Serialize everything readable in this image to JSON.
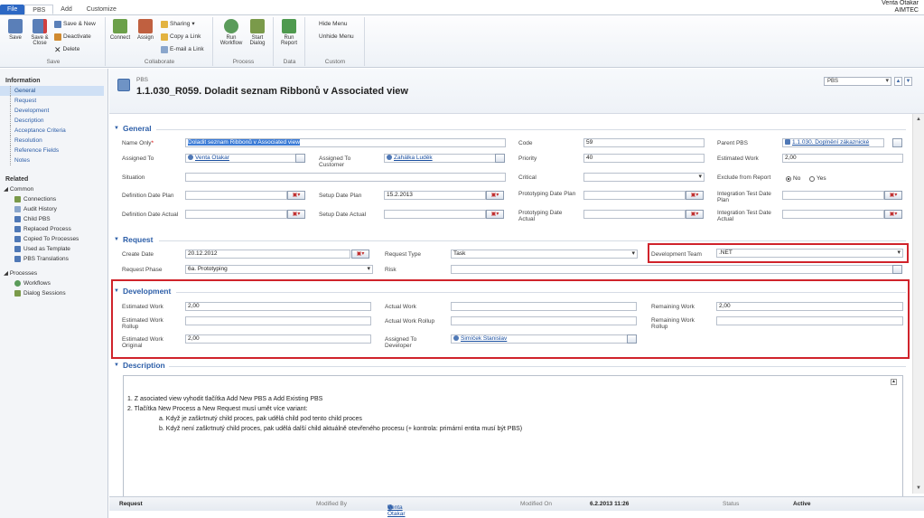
{
  "user": {
    "name": "Venta Otakar",
    "org": "AIMTEC"
  },
  "tabs": [
    "File",
    "PBS",
    "Add",
    "Customize"
  ],
  "ribbon": {
    "groups": {
      "save": {
        "label": "Save",
        "save": "Save",
        "save_close": "Save & Close",
        "save_new": "Save & New",
        "deactivate": "Deactivate",
        "delete": "Delete"
      },
      "collaborate": {
        "label": "Collaborate",
        "connect": "Connect",
        "assign": "Assign",
        "sharing": "Sharing",
        "copy_link": "Copy a Link",
        "email_link": "E-mail a Link"
      },
      "process": {
        "label": "Process",
        "run_workflow": "Run Workflow",
        "start_dialog": "Start Dialog"
      },
      "data": {
        "label": "Data",
        "run_report": "Run Report"
      },
      "custom": {
        "label": "Custom",
        "hide_menu": "Hide Menu",
        "unhide_menu": "Unhide Menu"
      }
    }
  },
  "nav": {
    "information_title": "Information",
    "information_items": [
      "General",
      "Request",
      "Development",
      "Description",
      "Acceptance Criteria",
      "Resolution",
      "Reference Fields",
      "Notes"
    ],
    "related_title": "Related",
    "common_title": "Common",
    "common_items": [
      "Connections",
      "Audit History",
      "Child PBS",
      "Replaced Process",
      "Copied To Processes",
      "Used as Template",
      "PBS Translations"
    ],
    "processes_title": "Processes",
    "processes_items": [
      "Workflows",
      "Dialog Sessions"
    ]
  },
  "header": {
    "entity": "PBS",
    "title": "1.1.030_R059. Doladit seznam Ribbonů v Associated view",
    "form_selector": "PBS"
  },
  "general": {
    "title": "General",
    "name_only_label": "Name Only",
    "name_only_value": "Doladit seznam Ribbonů v Associated view",
    "assigned_to_label": "Assigned To",
    "assigned_to_value": "Venta Otakar",
    "assigned_to_customer_label": "Assigned To Customer",
    "assigned_to_customer_value": "Zahálka Luděk",
    "situation_label": "Situation",
    "def_date_plan_label": "Definition Date Plan",
    "setup_date_plan_label": "Setup Date Plan",
    "setup_date_plan_value": "15.2.2013",
    "def_date_actual_label": "Definition Date Actual",
    "setup_date_actual_label": "Setup Date Actual",
    "code_label": "Code",
    "code_value": "59",
    "priority_label": "Priority",
    "priority_value": "40",
    "critical_label": "Critical",
    "proto_date_plan_label": "Prototyping Date Plan",
    "proto_date_actual_label": "Prototyping Date Actual",
    "parent_pbs_label": "Parent PBS",
    "parent_pbs_value": "1.1.030. Doplnění zákaznické",
    "estimated_work_label": "Estimated Work",
    "estimated_work_value": "2,00",
    "exclude_report_label": "Exclude from Report",
    "radio_no": "No",
    "radio_yes": "Yes",
    "integration_date_plan_label": "Integration Test Date Plan",
    "integration_date_actual_label": "Integration Test Date Actual"
  },
  "request": {
    "title": "Request",
    "create_date_label": "Create Date",
    "create_date_value": "20.12.2012",
    "request_type_label": "Request Type",
    "request_type_value": "Task",
    "dev_team_label": "Development Team",
    "dev_team_value": ".NET",
    "request_phase_label": "Request Phase",
    "request_phase_value": "6a. Prototyping",
    "risk_label": "Risk"
  },
  "development": {
    "title": "Development",
    "estimated_work_label": "Estimated Work",
    "estimated_work_value": "2,00",
    "est_work_rollup_label": "Estimated Work Rollup",
    "est_work_original_label": "Estimated Work Original",
    "est_work_original_value": "2,00",
    "actual_work_label": "Actual Work",
    "actual_work_rollup_label": "Actual Work Rollup",
    "assigned_dev_label": "Assigned To Developer",
    "assigned_dev_value": "Šimíček Stanislav",
    "remaining_work_label": "Remaining Work",
    "remaining_work_value": "2,00",
    "remaining_rollup_label": "Remaining Work Rollup"
  },
  "description": {
    "title": "Description",
    "line1": "1. Z asociated view vyhodit tlačítka Add New PBS a Add Existing PBS",
    "line2": "2. Tlačítka New Process a New Request musí umět více variant:",
    "line3": "a.    Když je zaškrtnutý child proces, pak udělá child pod tento child proces",
    "line4": "b.    Když není zaškrtnutý child proces, pak udělá další child aktuálně otevřeného procesu (+ kontrola: primární entita musí být PBS)"
  },
  "footer": {
    "entity": "Request",
    "modified_by_label": "Modified By",
    "modified_by_value": "Venta Otakar",
    "modified_on_label": "Modified On",
    "modified_on_value": "6.2.2013 11:26",
    "status_label": "Status",
    "status_value": "Active"
  },
  "colors": {
    "accent": "#2c5ea8",
    "highlight": "#d0232b"
  }
}
